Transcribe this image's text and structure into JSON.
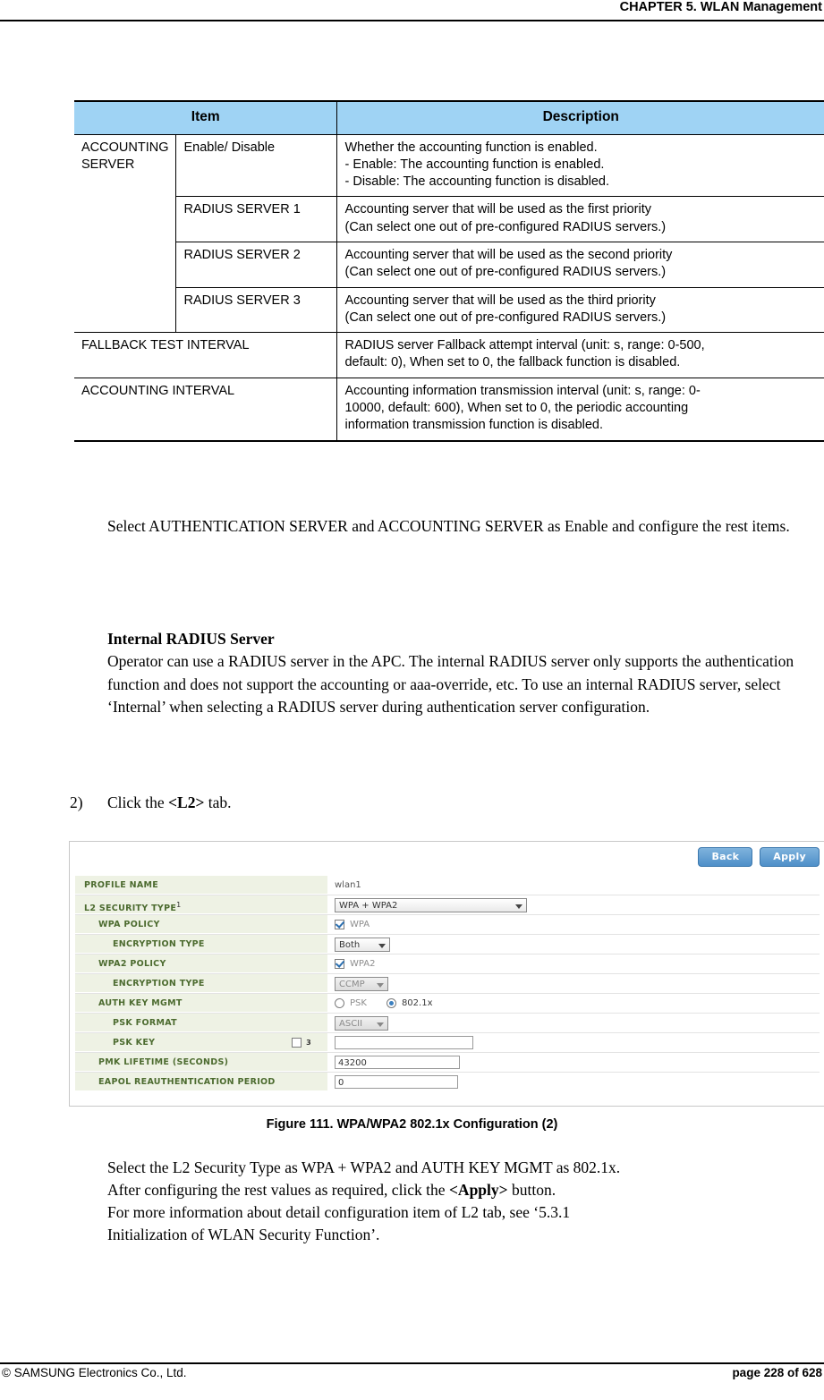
{
  "header": {
    "chapter": "CHAPTER 5. WLAN Management"
  },
  "table": {
    "headers": [
      "Item",
      "Description"
    ],
    "rows": [
      {
        "item": "ACCOUNTING SERVER",
        "sub": "Enable/ Disable",
        "description": [
          "Whether the accounting function is enabled.",
          "- Enable: The accounting function is enabled.",
          "- Disable: The accounting function is disabled."
        ]
      },
      {
        "item": "",
        "sub": "RADIUS SERVER 1",
        "description": [
          "Accounting server that will be used as the first priority",
          "(Can select one out of pre-configured RADIUS servers.)"
        ]
      },
      {
        "item": "",
        "sub": "RADIUS SERVER 2",
        "description": [
          "Accounting server that will be used as the second priority",
          "(Can select one out of pre-configured RADIUS servers.)"
        ]
      },
      {
        "item": "",
        "sub": "RADIUS SERVER 3",
        "description": [
          "Accounting server that will be used as the third priority",
          "(Can select one out of pre-configured RADIUS servers.)"
        ]
      },
      {
        "item": "FALLBACK TEST INTERVAL",
        "sub": null,
        "description": [
          "RADIUS server Fallback attempt interval (unit: s, range: 0-500,",
          "default: 0), When set to 0, the fallback function is disabled."
        ]
      },
      {
        "item": "ACCOUNTING INTERVAL",
        "sub": null,
        "description": [
          "Accounting information transmission interval (unit: s, range: 0-",
          "10000, default: 600), When set to 0, the periodic accounting",
          "information transmission function is disabled."
        ]
      }
    ]
  },
  "body": {
    "para1": "Select AUTHENTICATION SERVER and ACCOUNTING SERVER as Enable and configure the rest items.",
    "heading1": "Internal RADIUS Server",
    "para2": "Operator can use a RADIUS server in the APC. The internal RADIUS server only supports the authentication function and does not support the accounting or aaa-override, etc. To use an internal RADIUS server, select ‘Internal’ when selecting a RADIUS server during authentication server configuration.",
    "step_number": "2)",
    "step_text_prefix": "Click the ",
    "step_text_bold": "<L2>",
    "step_text_suffix": " tab.",
    "figure_caption": "Figure 111. WPA/WPA2 802.1x Configuration (2)",
    "para3_line1": "Select the L2 Security Type as WPA + WPA2 and AUTH KEY MGMT as 802.1x.",
    "para3_line2_prefix": "After configuring the rest values as required, click the ",
    "para3_line2_bold": "<Apply>",
    "para3_line2_suffix": " button.",
    "para3_line3": "For more information about detail configuration item of L2 tab, see ‘5.3.1",
    "para3_line4": "Initialization of WLAN Security Function’."
  },
  "screenshot": {
    "buttons": {
      "back": "Back",
      "apply": "Apply"
    },
    "rows": [
      {
        "label": "PROFILE NAME",
        "sup": "",
        "value": "wlan1",
        "type": "text"
      },
      {
        "label": "L2 SECURITY TYPE",
        "sup": "1",
        "value": "WPA + WPA2",
        "type": "select"
      },
      {
        "label": "WPA POLICY",
        "sup": "",
        "value": "WPA",
        "type": "checkbox",
        "checked": true
      },
      {
        "label": "ENCRYPTION TYPE",
        "sup": "",
        "value": "Both",
        "type": "select"
      },
      {
        "label": "WPA2 POLICY",
        "sup": "",
        "value": "WPA2",
        "type": "checkbox",
        "checked": true
      },
      {
        "label": "ENCRYPTION TYPE",
        "sup": "",
        "value": "CCMP",
        "type": "select-gray"
      },
      {
        "label": "AUTH KEY MGMT",
        "sup": "",
        "options": [
          "PSK",
          "802.1x"
        ],
        "selected": "802.1x",
        "type": "radio"
      },
      {
        "label": "PSK FORMAT",
        "sup": "",
        "value": "ASCII",
        "type": "select-gray"
      },
      {
        "label": "PSK KEY",
        "sup": "3",
        "value": "",
        "type": "input-check"
      },
      {
        "label": "PMK LIFETIME (SECONDS)",
        "sup": "",
        "value": "43200",
        "type": "input"
      },
      {
        "label": "EAPOL REAUTHENTICATION PERIOD",
        "sup": "",
        "value": "0",
        "type": "input"
      }
    ]
  },
  "footer": {
    "left": "© SAMSUNG Electronics Co., Ltd.",
    "right": "page 228 of 628"
  },
  "colors": {
    "table_header_bg": "#9fd3f4",
    "form_label_bg": "#eef2e4",
    "form_label_fg": "#4c6b2f",
    "button_blue": "#5b9bd5"
  }
}
